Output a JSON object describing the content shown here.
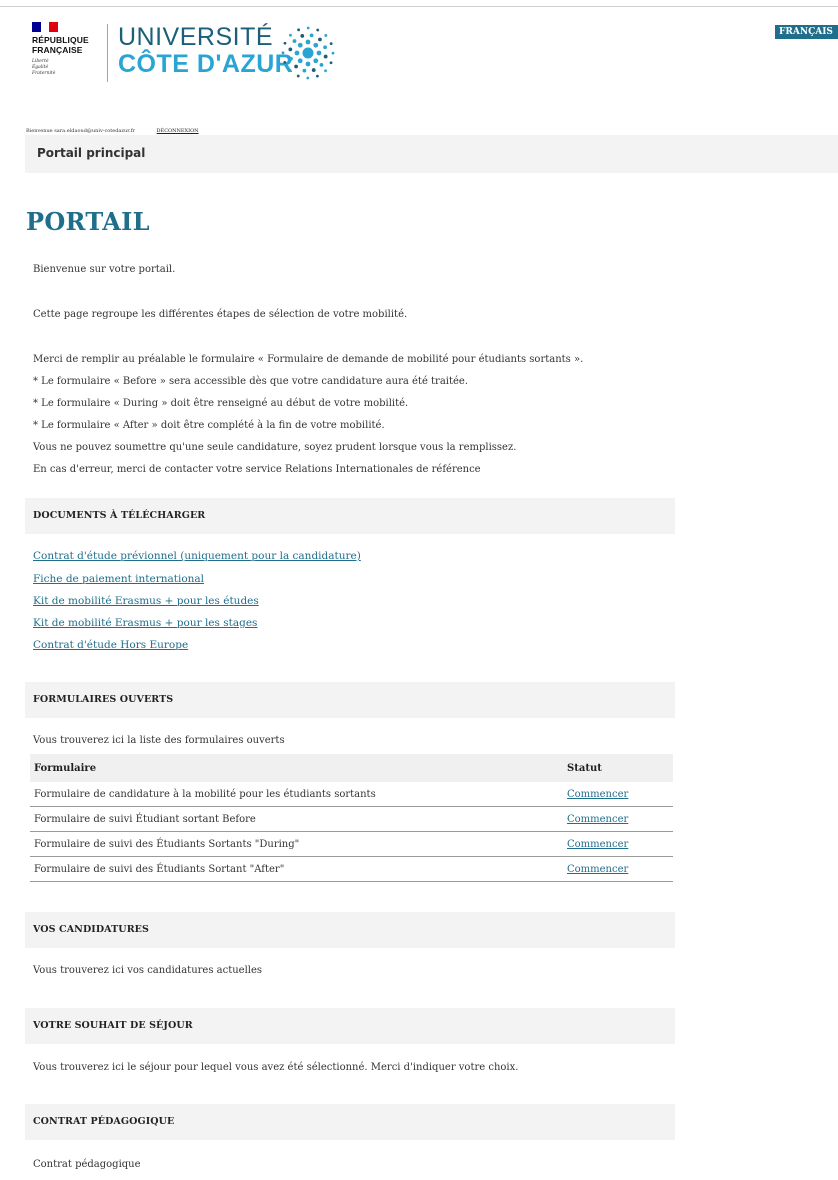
{
  "language": {
    "label": "FRANÇAIS"
  },
  "republique": {
    "flag_colors": [
      "#000091",
      "#ffffff",
      "#e1000f"
    ],
    "line1": "RÉPUBLIQUE",
    "line2": "FRANÇAISE",
    "motto": [
      "Liberté",
      "Égalité",
      "Fraternité"
    ]
  },
  "university": {
    "line1": "UNIVERSITÉ",
    "line2": "CÔTE D'AZUR",
    "colors": {
      "dark": "#1b5f79",
      "light": "#2aa5d3"
    }
  },
  "user_bar": {
    "welcome": "Bienvenue sara.eldaoud@univ-cotedazur.fr",
    "logout": "DÉCONNEXION"
  },
  "breadcrumb": "Portail principal",
  "page_title": "PORTAIL",
  "intro": {
    "welcome": "Bienvenue sur votre portail.",
    "description": "Cette page regroupe les différentes étapes de sélection de votre mobilité.",
    "instructions": [
      "Merci de remplir au préalable le formulaire « Formulaire de demande de mobilité pour étudiants sortants ».",
      "* Le formulaire « Before » sera accessible dès que votre candidature aura été traitée.",
      "* Le formulaire « During » doit être renseigné au début de votre mobilité.",
      "* Le formulaire « After » doit être complété à la fin de votre mobilité.",
      "Vous ne pouvez soumettre qu'une seule candidature, soyez prudent lorsque vous la remplissez.",
      "En cas d'erreur, merci de contacter votre service Relations Internationales de référence"
    ]
  },
  "documents": {
    "heading": "DOCUMENTS À TÉLÉCHARGER",
    "links": [
      "Contrat d'étude prévionnel (uniquement pour la candidature)",
      "Fiche de paiement international",
      "Kit de mobilité Erasmus + pour les études",
      "Kit de mobilité Erasmus + pour les stages",
      "Contrat d'étude Hors Europe"
    ]
  },
  "open_forms": {
    "heading": "FORMULAIRES OUVERTS",
    "description": "Vous trouverez ici la liste des formulaires ouverts",
    "columns": {
      "form": "Formulaire",
      "status": "Statut"
    },
    "rows": [
      {
        "name": "Formulaire de candidature à la mobilité pour les étudiants sortants",
        "action": "Commencer"
      },
      {
        "name": "Formulaire de suivi Étudiant sortant Before",
        "action": "Commencer"
      },
      {
        "name": "Formulaire de suivi des Étudiants Sortants \"During\"",
        "action": "Commencer"
      },
      {
        "name": "Formulaire de suivi des Étudiants Sortant \"After\"",
        "action": "Commencer"
      }
    ]
  },
  "applications": {
    "heading": "VOS CANDIDATURES",
    "description": "Vous trouverez ici vos candidatures actuelles"
  },
  "stay_wish": {
    "heading": "VOTRE SOUHAIT DE SÉJOUR",
    "description": "Vous trouverez ici le séjour pour lequel vous avez été sélectionné. Merci d'indiquer votre choix."
  },
  "learning_agreement": {
    "heading": "CONTRAT PÉDAGOGIQUE",
    "description": "Contrat pédagogique"
  }
}
